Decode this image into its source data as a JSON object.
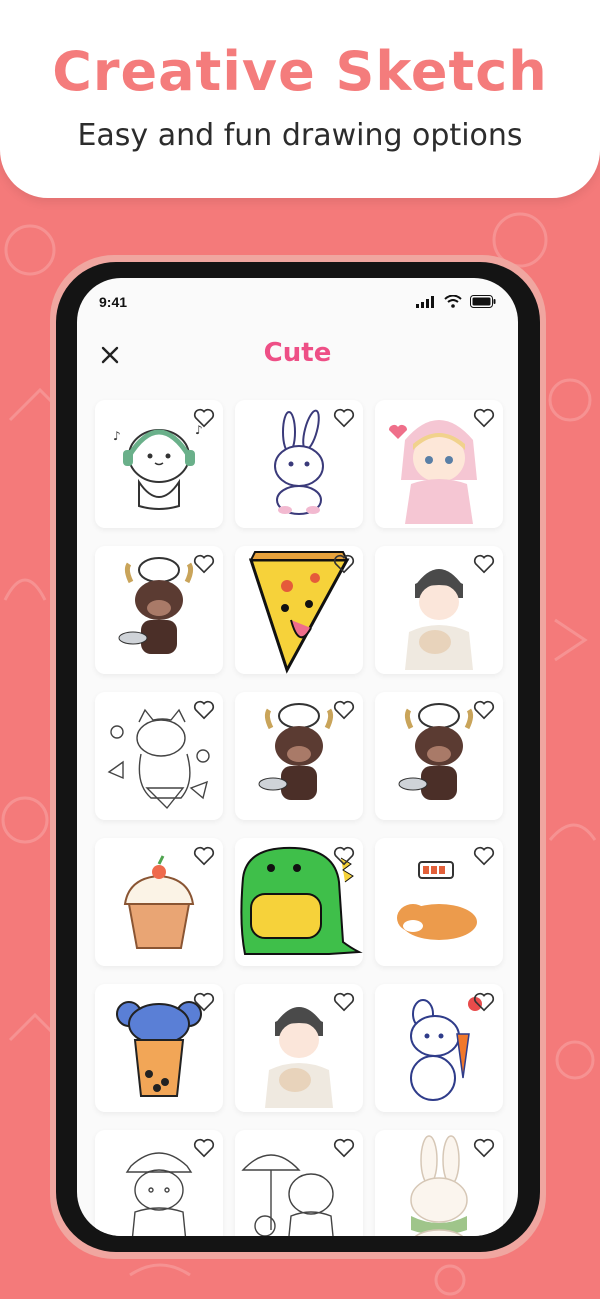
{
  "banner": {
    "title": "Creative Sketch",
    "subtitle": "Easy and fun drawing options"
  },
  "status_bar": {
    "time": "9:41"
  },
  "screen": {
    "title": "Cute"
  },
  "colors": {
    "background": "#f47a7a",
    "title_coral": "#f47c7c",
    "screen_title_pink": "#ee4f86"
  },
  "grid": {
    "items": [
      {
        "name": "mochi-headphones",
        "favorited": false
      },
      {
        "name": "bunny",
        "favorited": false
      },
      {
        "name": "anime-boy-hoodie",
        "favorited": false
      },
      {
        "name": "bull-chef",
        "favorited": false
      },
      {
        "name": "pizza-slice",
        "favorited": false
      },
      {
        "name": "boy-with-cat",
        "favorited": false
      },
      {
        "name": "cat-outline-sketch",
        "favorited": false
      },
      {
        "name": "bull-chef",
        "favorited": false
      },
      {
        "name": "bull-chef",
        "favorited": false
      },
      {
        "name": "cupcake",
        "favorited": false
      },
      {
        "name": "green-dino",
        "favorited": false
      },
      {
        "name": "shiba-battery",
        "favorited": false
      },
      {
        "name": "bubble-tea-koala",
        "favorited": false
      },
      {
        "name": "boy-with-cat",
        "favorited": false
      },
      {
        "name": "bunny-carrot",
        "favorited": false
      },
      {
        "name": "girl-outline-sketch",
        "favorited": false
      },
      {
        "name": "girls-umbrella-sketch",
        "favorited": false
      },
      {
        "name": "bunny-pastel",
        "favorited": false
      }
    ]
  }
}
